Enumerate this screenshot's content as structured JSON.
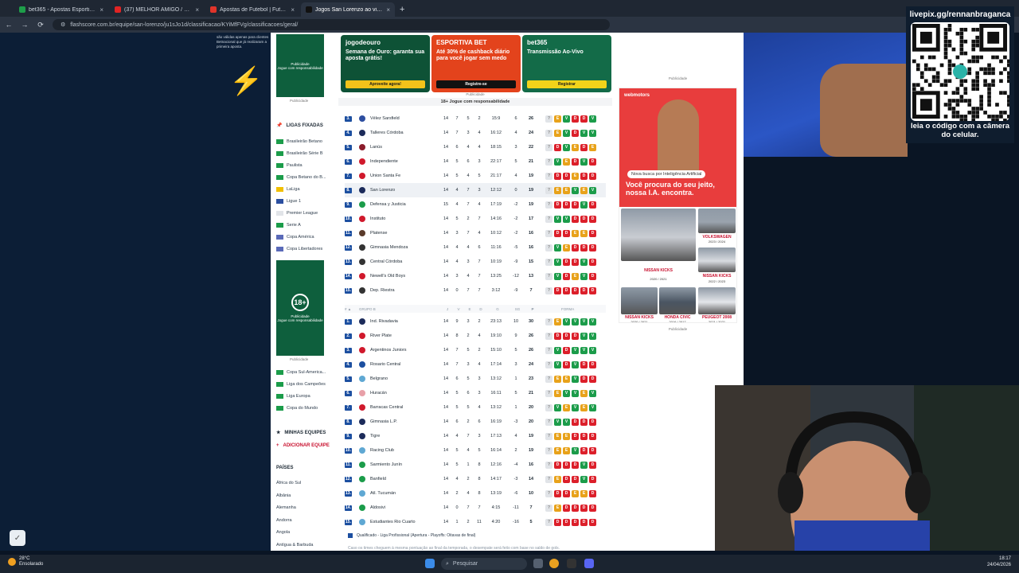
{
  "tabs": [
    {
      "title": "bet365 - Apostas Esportivas Cr",
      "color": "#1e9e4a",
      "active": false
    },
    {
      "title": "(37) MELHOR AMIGO / O C",
      "color": "#e02424",
      "active": false
    },
    {
      "title": "Apostas de Futebol | Futebol Br",
      "color": "#e0342a",
      "active": false
    },
    {
      "title": "Jogos San Lorenzo ao vivo, tab",
      "color": "#111111",
      "active": true
    }
  ],
  "address": {
    "url": "flashscore.com.br/equipe/san-lorenzo/ju1sJo1d/classificacao/KYiMfFVg/classificacoes/geral/"
  },
  "promo_left": "são válidas apenas para clientes Betnacional que já realizaram a primeira aposta.",
  "sidebar": {
    "ad_pub": "Publicidade",
    "ad_text_1": "Jogue com responsabilidade",
    "ad_age": "18+",
    "ad_text_2": "Jogue com responsabilidade",
    "ligas_title": "LIGAS FIXADAS",
    "ligas": [
      "Brasileirão Betano",
      "Brasileirão Série B",
      "Paulista",
      "Copa Betano do B...",
      "LaLiga",
      "Ligue 1",
      "Premier League",
      "Serie A",
      "Copa América",
      "Copa Libertadores"
    ],
    "ligas2": [
      "Copa Sul-America...",
      "Liga dos Campeões",
      "Liga Europa",
      "Copa do Mundo"
    ],
    "minhas": "MINHAS EQUIPES",
    "adicionar": "ADICIONAR EQUIPE",
    "paises_title": "PAÍSES",
    "paises": [
      "África do Sul",
      "Albânia",
      "Alemanha",
      "Andorra",
      "Angola",
      "Antígua & Barbuda"
    ]
  },
  "ads": [
    {
      "brand": "jogodeouro",
      "text": "Semana de Ouro: garanta sua aposta grátis!",
      "button": "Aproveite agora!",
      "bg": "#0e5236",
      "btnbg": "#f2c21a",
      "btncolor": "#1a1a1a"
    },
    {
      "brand": "ESPORTIVA BET",
      "text": "Até 30% de cashback diário para você jogar sem medo",
      "button": "Registre-se",
      "bg": "#e3431c",
      "btnbg": "#111111",
      "btncolor": "#ffffff"
    },
    {
      "brand": "bet365",
      "text": "Transmissão Ao-Vivo",
      "button": "Registrar",
      "bg": "#136b48",
      "btnbg": "#f2d31a",
      "btncolor": "#1a1a1a"
    }
  ],
  "pub_label": "Publicidade",
  "resp_banner": "18+ Jogue com responsabilidade",
  "groupA": [
    {
      "rank": "3.",
      "team": "Vélez Sarsfield",
      "j": "14",
      "v": "7",
      "e": "5",
      "d": "2",
      "g": "15:9",
      "sg": "6",
      "p": "26",
      "form": [
        "Q",
        "E",
        "V",
        "D",
        "D",
        "V"
      ],
      "logo": "#2d4ea0"
    },
    {
      "rank": "4.",
      "team": "Talleres Córdoba",
      "j": "14",
      "v": "7",
      "e": "3",
      "d": "4",
      "g": "16:12",
      "sg": "4",
      "p": "24",
      "form": [
        "Q",
        "E",
        "V",
        "D",
        "V",
        "V"
      ],
      "logo": "#1c2b5a"
    },
    {
      "rank": "5.",
      "team": "Lanús",
      "j": "14",
      "v": "6",
      "e": "4",
      "d": "4",
      "g": "18:15",
      "sg": "3",
      "p": "22",
      "form": [
        "Q",
        "D",
        "V",
        "E",
        "D",
        "E"
      ],
      "logo": "#8b1c2b"
    },
    {
      "rank": "6.",
      "team": "Independiente",
      "j": "14",
      "v": "5",
      "e": "6",
      "d": "3",
      "g": "22:17",
      "sg": "5",
      "p": "21",
      "form": [
        "Q",
        "V",
        "E",
        "D",
        "V",
        "D"
      ],
      "logo": "#d0192c"
    },
    {
      "rank": "7.",
      "team": "Union Santa Fe",
      "j": "14",
      "v": "5",
      "e": "4",
      "d": "5",
      "g": "21:17",
      "sg": "4",
      "p": "19",
      "form": [
        "Q",
        "D",
        "D",
        "E",
        "D",
        "D"
      ],
      "logo": "#d0192c"
    },
    {
      "rank": "8.",
      "team": "San Lorenzo",
      "j": "14",
      "v": "4",
      "e": "7",
      "d": "3",
      "g": "12:12",
      "sg": "0",
      "p": "19",
      "form": [
        "Q",
        "E",
        "E",
        "V",
        "E",
        "V"
      ],
      "logo": "#1c2b5a",
      "hl": true
    },
    {
      "rank": "9.",
      "team": "Defensa y Justicia",
      "j": "15",
      "v": "4",
      "e": "7",
      "d": "4",
      "g": "17:19",
      "sg": "-2",
      "p": "19",
      "form": [
        "Q",
        "D",
        "D",
        "D",
        "V",
        "D"
      ],
      "logo": "#1b9c4a"
    },
    {
      "rank": "10.",
      "team": "Instituto",
      "j": "14",
      "v": "5",
      "e": "2",
      "d": "7",
      "g": "14:16",
      "sg": "-2",
      "p": "17",
      "form": [
        "Q",
        "V",
        "V",
        "D",
        "D",
        "D"
      ],
      "logo": "#d0192c"
    },
    {
      "rank": "11.",
      "team": "Platense",
      "j": "14",
      "v": "3",
      "e": "7",
      "d": "4",
      "g": "10:12",
      "sg": "-2",
      "p": "16",
      "form": [
        "Q",
        "D",
        "D",
        "E",
        "E",
        "D"
      ],
      "logo": "#5a3a2a"
    },
    {
      "rank": "12.",
      "team": "Gimnasia Mendoza",
      "j": "14",
      "v": "4",
      "e": "4",
      "d": "6",
      "g": "11:16",
      "sg": "-5",
      "p": "16",
      "form": [
        "Q",
        "V",
        "E",
        "D",
        "D",
        "D"
      ],
      "logo": "#333333"
    },
    {
      "rank": "13.",
      "team": "Central Córdoba",
      "j": "14",
      "v": "4",
      "e": "3",
      "d": "7",
      "g": "10:19",
      "sg": "-9",
      "p": "15",
      "form": [
        "Q",
        "V",
        "D",
        "D",
        "V",
        "D"
      ],
      "logo": "#333333"
    },
    {
      "rank": "14.",
      "team": "Newell's Old Boys",
      "j": "14",
      "v": "3",
      "e": "4",
      "d": "7",
      "g": "13:25",
      "sg": "-12",
      "p": "13",
      "form": [
        "Q",
        "V",
        "D",
        "E",
        "V",
        "D"
      ],
      "logo": "#d0192c"
    },
    {
      "rank": "15.",
      "team": "Dep. Riestra",
      "j": "14",
      "v": "0",
      "e": "7",
      "d": "7",
      "g": "3:12",
      "sg": "-9",
      "p": "7",
      "form": [
        "Q",
        "D",
        "D",
        "D",
        "D",
        "D"
      ],
      "logo": "#333333"
    }
  ],
  "groupB_header": {
    "pos": "# ▲",
    "name": "GRUPO B",
    "j": "J",
    "v": "V",
    "e": "E",
    "d": "D",
    "g": "G",
    "sg": "SG",
    "p": "P",
    "form": "FORMA"
  },
  "groupB": [
    {
      "rank": "1.",
      "team": "Ind. Rivadavia",
      "j": "14",
      "v": "9",
      "e": "3",
      "d": "2",
      "g": "23:13",
      "sg": "10",
      "p": "30",
      "form": [
        "Q",
        "E",
        "V",
        "V",
        "V",
        "V"
      ],
      "logo": "#1c2b5a"
    },
    {
      "rank": "2.",
      "team": "River Plate",
      "j": "14",
      "v": "8",
      "e": "2",
      "d": "4",
      "g": "19:10",
      "sg": "9",
      "p": "26",
      "form": [
        "Q",
        "D",
        "D",
        "D",
        "V",
        "V"
      ],
      "logo": "#d0192c"
    },
    {
      "rank": "3.",
      "team": "Argentinos Juniors",
      "j": "14",
      "v": "7",
      "e": "5",
      "d": "2",
      "g": "15:10",
      "sg": "5",
      "p": "26",
      "form": [
        "Q",
        "V",
        "D",
        "V",
        "V",
        "V"
      ],
      "logo": "#d0192c"
    },
    {
      "rank": "4.",
      "team": "Rosario Central",
      "j": "14",
      "v": "7",
      "e": "3",
      "d": "4",
      "g": "17:14",
      "sg": "3",
      "p": "24",
      "form": [
        "Q",
        "V",
        "D",
        "V",
        "D",
        "D"
      ],
      "logo": "#1c4fa0"
    },
    {
      "rank": "5.",
      "team": "Belgrano",
      "j": "14",
      "v": "6",
      "e": "5",
      "d": "3",
      "g": "13:12",
      "sg": "1",
      "p": "23",
      "form": [
        "Q",
        "E",
        "E",
        "V",
        "D",
        "D"
      ],
      "logo": "#5fa8d3"
    },
    {
      "rank": "6.",
      "team": "Huracán",
      "j": "14",
      "v": "5",
      "e": "6",
      "d": "3",
      "g": "16:11",
      "sg": "5",
      "p": "21",
      "form": [
        "Q",
        "E",
        "V",
        "V",
        "E",
        "V"
      ],
      "logo": "#e8a0a8"
    },
    {
      "rank": "7.",
      "team": "Barracas Central",
      "j": "14",
      "v": "5",
      "e": "5",
      "d": "4",
      "g": "13:12",
      "sg": "1",
      "p": "20",
      "form": [
        "Q",
        "V",
        "E",
        "V",
        "E",
        "V"
      ],
      "logo": "#d0192c"
    },
    {
      "rank": "8.",
      "team": "Gimnasia L.P.",
      "j": "14",
      "v": "6",
      "e": "2",
      "d": "6",
      "g": "16:19",
      "sg": "-3",
      "p": "20",
      "form": [
        "Q",
        "V",
        "V",
        "D",
        "D",
        "D"
      ],
      "logo": "#1c2b5a"
    },
    {
      "rank": "9.",
      "team": "Tigre",
      "j": "14",
      "v": "4",
      "e": "7",
      "d": "3",
      "g": "17:13",
      "sg": "4",
      "p": "19",
      "form": [
        "Q",
        "E",
        "E",
        "D",
        "D",
        "D"
      ],
      "logo": "#1c2b5a"
    },
    {
      "rank": "10.",
      "team": "Racing Club",
      "j": "14",
      "v": "5",
      "e": "4",
      "d": "5",
      "g": "16:14",
      "sg": "2",
      "p": "19",
      "form": [
        "Q",
        "E",
        "E",
        "V",
        "D",
        "D"
      ],
      "logo": "#5fa8d3"
    },
    {
      "rank": "11.",
      "team": "Sarmiento Junín",
      "j": "14",
      "v": "5",
      "e": "1",
      "d": "8",
      "g": "12:16",
      "sg": "-4",
      "p": "16",
      "form": [
        "Q",
        "D",
        "D",
        "D",
        "V",
        "D"
      ],
      "logo": "#1b9c4a"
    },
    {
      "rank": "12.",
      "team": "Banfield",
      "j": "14",
      "v": "4",
      "e": "2",
      "d": "8",
      "g": "14:17",
      "sg": "-3",
      "p": "14",
      "form": [
        "Q",
        "E",
        "D",
        "D",
        "V",
        "D"
      ],
      "logo": "#1b9c4a"
    },
    {
      "rank": "13.",
      "team": "Atl. Tucumán",
      "j": "14",
      "v": "2",
      "e": "4",
      "d": "8",
      "g": "13:19",
      "sg": "-6",
      "p": "10",
      "form": [
        "Q",
        "D",
        "D",
        "E",
        "E",
        "D"
      ],
      "logo": "#5fa8d3"
    },
    {
      "rank": "14.",
      "team": "Aldosivi",
      "j": "14",
      "v": "0",
      "e": "7",
      "d": "7",
      "g": "4:15",
      "sg": "-11",
      "p": "7",
      "form": [
        "Q",
        "E",
        "D",
        "D",
        "D",
        "D"
      ],
      "logo": "#1b9c4a"
    },
    {
      "rank": "15.",
      "team": "Estudiantes Rio Cuarto",
      "j": "14",
      "v": "1",
      "e": "2",
      "d": "11",
      "g": "4:20",
      "sg": "-16",
      "p": "5",
      "form": [
        "Q",
        "D",
        "D",
        "D",
        "D",
        "D"
      ],
      "logo": "#5fa8d3"
    }
  ],
  "legend": "Qualificado - Liga Profissional (Apertura - Playoffs: Oitavas de final)",
  "note": "Caso os times cheguem à mesma pontuação ao final da temporada, o desempate será feito com base no saldo de gols.",
  "webmotors": {
    "logo": "webmotors",
    "chip": "Nova busca por Inteligência Artificial",
    "headline": "Você procura do seu jeito, nossa I.A. encontra.",
    "cars": [
      {
        "name": "NISSAN KICKS",
        "year": "2020 / 2021"
      },
      {
        "name": "VOLKSWAGEN",
        "year": "2023 / 2024"
      },
      {
        "name": "NISSAN KICKS",
        "year": "2022 / 2023"
      },
      {
        "name": "NISSAN KICKS",
        "year": "2020 / 2021"
      },
      {
        "name": "HONDA CIVIC",
        "year": "2016 / 2017"
      },
      {
        "name": "PEUGEOT 2008",
        "year": "2021 / 2021"
      }
    ]
  },
  "overlay": {
    "caption": "livepix.gg/rennanbraganca",
    "scan": "leia o código com a câmera do celular."
  },
  "taskbar": {
    "temp": "28°C",
    "weather": "Ensolarado",
    "search": "Pesquisar",
    "time": "18:17",
    "date": "24/04/2026"
  }
}
